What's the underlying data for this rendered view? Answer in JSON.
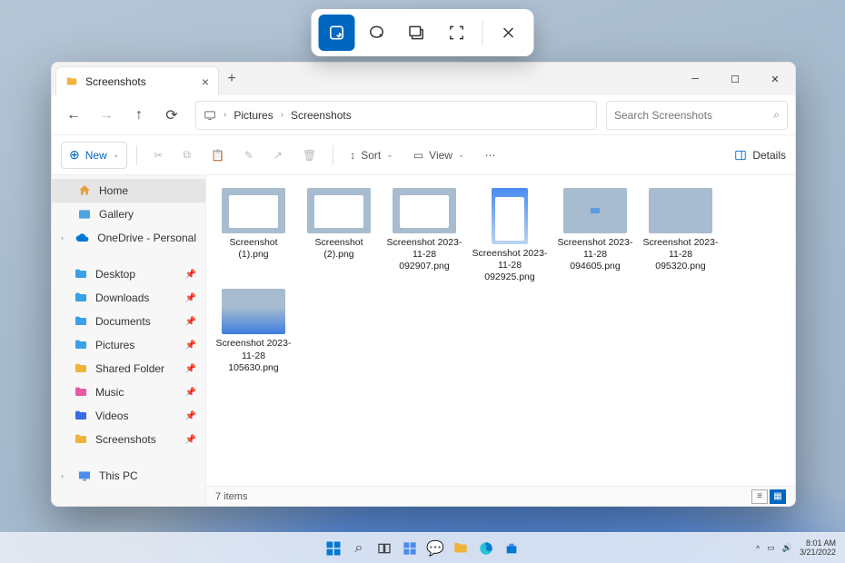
{
  "snip": {
    "tools": [
      "rectangle",
      "freeform",
      "window",
      "fullscreen",
      "close"
    ]
  },
  "window": {
    "tab_title": "Screenshots",
    "breadcrumb": [
      "Pictures",
      "Screenshots"
    ],
    "search_placeholder": "Search Screenshots",
    "new_label": "New",
    "sort_label": "Sort",
    "view_label": "View",
    "details_label": "Details",
    "status": "7 items"
  },
  "sidebar": {
    "items": [
      {
        "label": "Home",
        "active": true,
        "ico": "#e9a13b",
        "kind": "home"
      },
      {
        "label": "Gallery",
        "ico": "#4fa3e0",
        "kind": "gallery"
      },
      {
        "label": "OneDrive - Personal",
        "ico": "#0078d4",
        "kind": "cloud",
        "caret": true
      }
    ],
    "pinned": [
      {
        "label": "Desktop",
        "ico": "#3aa0e8"
      },
      {
        "label": "Downloads",
        "ico": "#3aa0e8"
      },
      {
        "label": "Documents",
        "ico": "#3aa0e8"
      },
      {
        "label": "Pictures",
        "ico": "#3aa0e8"
      },
      {
        "label": "Shared Folder",
        "ico": "#f0b43c"
      },
      {
        "label": "Music",
        "ico": "#e85aa0"
      },
      {
        "label": "Videos",
        "ico": "#3a6ae8"
      },
      {
        "label": "Screenshots",
        "ico": "#f0b43c"
      }
    ],
    "thispc": "This PC"
  },
  "files": [
    {
      "name": "Screenshot (1).png",
      "thumb": "win"
    },
    {
      "name": "Screenshot (2).png",
      "thumb": "win"
    },
    {
      "name": "Screenshot 2023-11-28 092907.png",
      "thumb": "win"
    },
    {
      "name": "Screenshot 2023-11-28 092925.png",
      "thumb": "tall"
    },
    {
      "name": "Screenshot 2023-11-28 094605.png",
      "thumb": "tiny"
    },
    {
      "name": "Screenshot 2023-11-28 095320.png",
      "thumb": "pale"
    },
    {
      "name": "Screenshot 2023-11-28 105630.png",
      "thumb": "wave"
    }
  ],
  "taskbar": {
    "time": "8:01 AM",
    "date": "3/21/2022"
  }
}
